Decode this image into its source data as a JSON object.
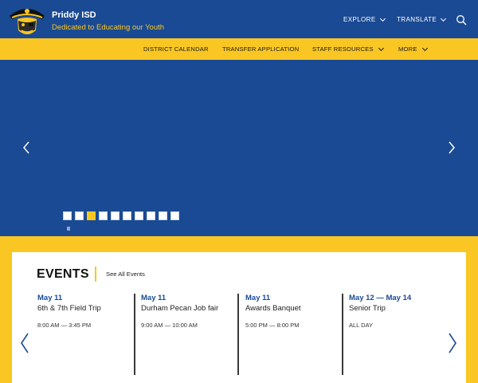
{
  "header": {
    "site_name": "Priddy ISD",
    "tagline": "Dedicated to Educating our Youth",
    "explore_label": "EXPLORE",
    "translate_label": "TRANSLATE"
  },
  "subnav": {
    "items": [
      {
        "label": "DISTRICT CALENDAR"
      },
      {
        "label": "TRANSFER APPLICATION"
      },
      {
        "label": "STAFF RESOURCES"
      },
      {
        "label": "MORE"
      }
    ]
  },
  "hero": {
    "slide_count": 10,
    "active_slide": 3,
    "pause_label": "II"
  },
  "events": {
    "title": "EVENTS",
    "see_all": "See All Events",
    "items": [
      {
        "date": "May 11",
        "name": "6th & 7th Field Trip",
        "time": "8:00 AM — 3:45 PM"
      },
      {
        "date": "May 11",
        "name": "Durham Pecan Job fair",
        "time": "9:00 AM — 10:00 AM"
      },
      {
        "date": "May 11",
        "name": "Awards Banquet",
        "time": "5:00 PM — 8:00 PM"
      },
      {
        "date": "May 12 — May 14",
        "name": "Senior Trip",
        "time": "ALL DAY"
      }
    ]
  },
  "colors": {
    "primary_blue": "#1a4a93",
    "accent_gold": "#f9c623"
  },
  "icons": [
    "pirate-logo-icon",
    "search-icon",
    "chevron-down-icon",
    "chevron-left-icon",
    "chevron-right-icon"
  ]
}
